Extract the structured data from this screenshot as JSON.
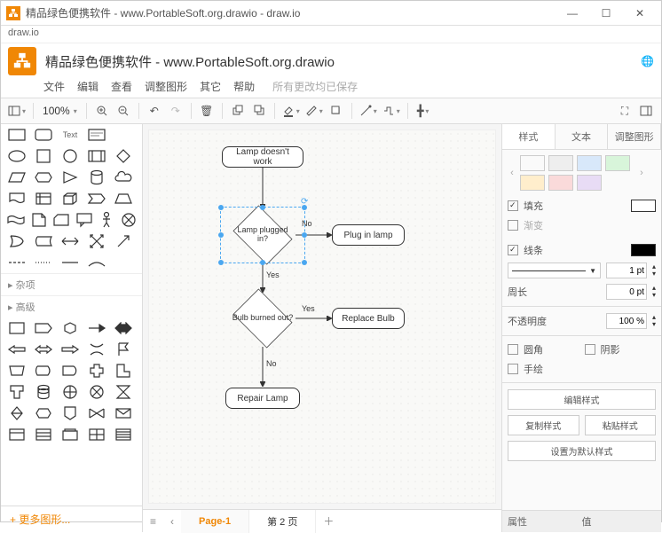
{
  "titlebar": {
    "text": "精品绿色便携软件 - www.PortableSoft.org.drawio - draw.io"
  },
  "address": "draw.io",
  "doc": {
    "name": "精品绿色便携软件 - www.PortableSoft.org.drawio"
  },
  "menu": {
    "file": "文件",
    "edit": "编辑",
    "view": "查看",
    "format": "调整图形",
    "extras": "其它",
    "help": "帮助",
    "saved": "所有更改均已保存"
  },
  "toolbar": {
    "zoom": "100%"
  },
  "shapes": {
    "text_label": "Text",
    "cat_misc": "杂项",
    "cat_advanced": "高级",
    "more": "+ 更多图形..."
  },
  "flow": {
    "n1": "Lamp doesn't work",
    "n2": "Lamp plugged in?",
    "n3": "Plug in lamp",
    "n4": "Bulb burned out?",
    "n5": "Replace Bulb",
    "n6": "Repair Lamp",
    "yes": "Yes",
    "no": "No"
  },
  "tabs": {
    "p1": "Page-1",
    "p2": "第 2 页"
  },
  "rpanel": {
    "tab_style": "样式",
    "tab_text": "文本",
    "tab_arrange": "调整图形",
    "colors": [
      "#ffffff",
      "#eeeeee",
      "#d8e8fa",
      "#d8f5da",
      "#ffeecc",
      "#fadada",
      "#e8dcf5"
    ],
    "fill_lbl": "填充",
    "fill_val": "#ffffff",
    "gradient_lbl": "渐变",
    "line_lbl": "线条",
    "line_val": "#000000",
    "line_width": "1 pt",
    "perimeter_lbl": "周长",
    "perimeter_val": "0 pt",
    "opacity_lbl": "不透明度",
    "opacity_val": "100 %",
    "rounded_lbl": "圆角",
    "shadow_lbl": "阴影",
    "sketch_lbl": "手绘",
    "edit_style": "编辑样式",
    "copy_style": "复制样式",
    "paste_style": "粘贴样式",
    "default_style": "设置为默认样式",
    "attr_lbl": "属性",
    "val_lbl": "值"
  }
}
